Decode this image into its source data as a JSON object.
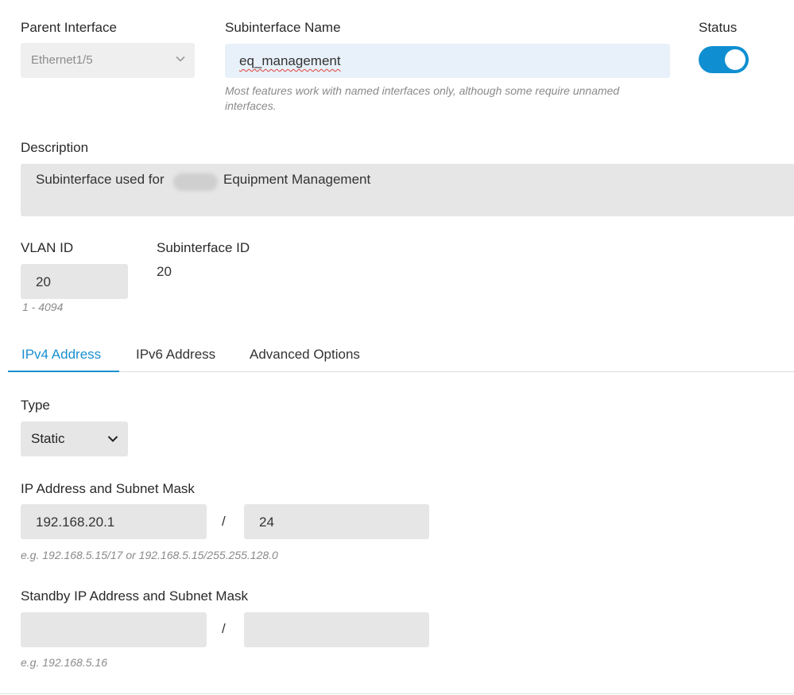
{
  "parent_interface": {
    "label": "Parent Interface",
    "value": "Ethernet1/5"
  },
  "subinterface_name": {
    "label": "Subinterface Name",
    "value": "eq_management",
    "hint": "Most features work with named interfaces only, although some require unnamed interfaces."
  },
  "status": {
    "label": "Status",
    "enabled": true
  },
  "description": {
    "label": "Description",
    "value_before": "Subinterface used for",
    "value_after": "Equipment Management"
  },
  "vlan": {
    "label": "VLAN ID",
    "value": "20",
    "hint": "1 - 4094"
  },
  "subinterface_id": {
    "label": "Subinterface ID",
    "value": "20"
  },
  "tabs": [
    {
      "label": "IPv4 Address",
      "active": true
    },
    {
      "label": "IPv6 Address",
      "active": false
    },
    {
      "label": "Advanced Options",
      "active": false
    }
  ],
  "type": {
    "label": "Type",
    "value": "Static"
  },
  "ip": {
    "label": "IP Address and Subnet Mask",
    "address": "192.168.20.1",
    "separator": "/",
    "mask": "24",
    "hint": "e.g. 192.168.5.15/17 or 192.168.5.15/255.255.128.0"
  },
  "standby": {
    "label": "Standby IP Address and Subnet Mask",
    "address": "",
    "separator": "/",
    "mask": "",
    "hint": "e.g. 192.168.5.16"
  },
  "colors": {
    "accent": "#0f8fd1",
    "field_bg": "#e6e6e6",
    "focused_field_bg": "#e8f1f9"
  },
  "icons": {
    "select_chevron": "chevron-down-icon"
  }
}
